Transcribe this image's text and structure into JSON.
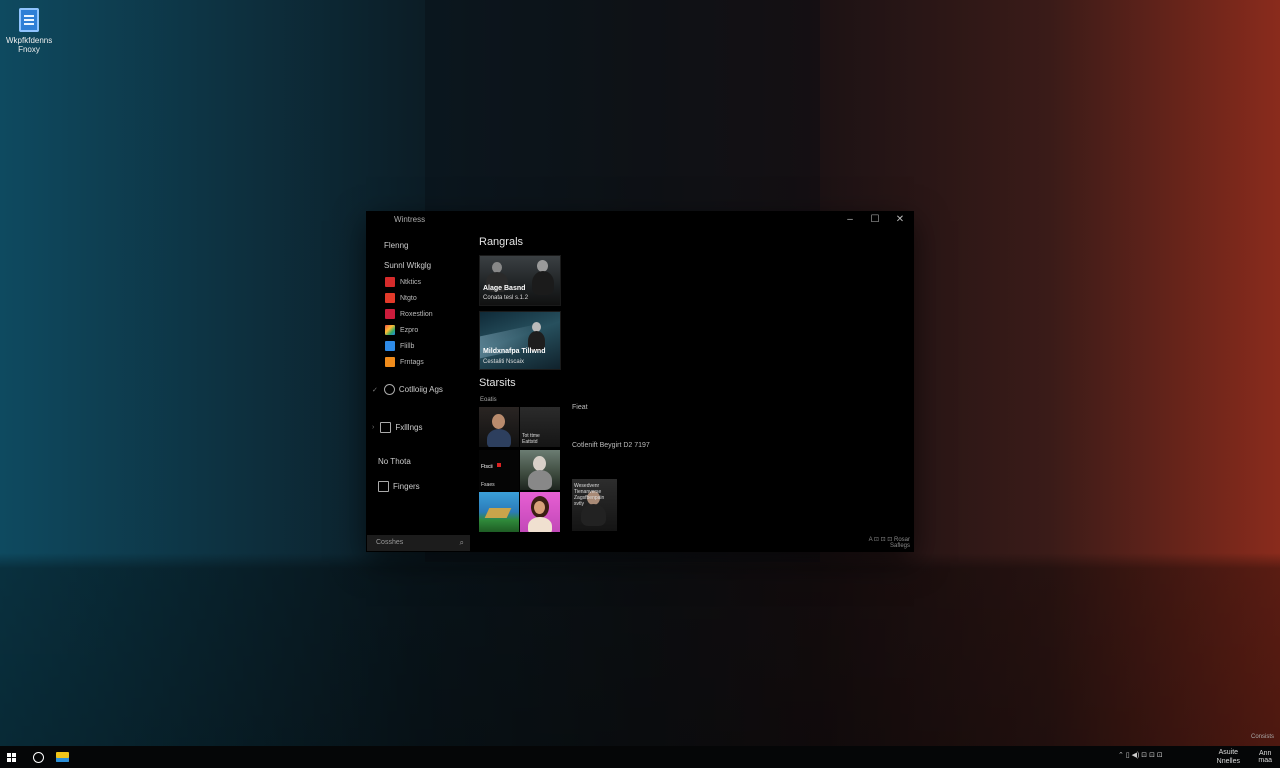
{
  "desktop": {
    "icon_label": "Wkpfkfdenns\nFnoxy",
    "corner_note": "Consists"
  },
  "window": {
    "title": "Wintress",
    "controls": {
      "minimize": "–",
      "maximize": "☐",
      "close": "✕"
    }
  },
  "sidebar": {
    "top_item": "Flenng",
    "group_label": "Sunnl Wtkglg",
    "apps": [
      {
        "label": "Ntktics",
        "color": "#d62b2b"
      },
      {
        "label": "Ntgto",
        "color": "#e23a2a"
      },
      {
        "label": "Roxestlion",
        "color": "#cc1c3c"
      },
      {
        "label": "Ezpro",
        "color": "#3aa86b"
      },
      {
        "label": "Flillb",
        "color": "#2e8ae6"
      },
      {
        "label": "Frntags",
        "color": "#f08c1c"
      }
    ],
    "item_controlling": "Cotlloiig Ags",
    "item_fallings": "Fxlllngs",
    "item_no_thota": "No Thota",
    "item_fingers": "Fingers",
    "search_placeholder": "Cosshes"
  },
  "content": {
    "section1_title": "Rangrals",
    "card1": {
      "title": "Alage Basnd",
      "subtitle": "Conata tesl s.1.2"
    },
    "card2": {
      "title": "Mildxnafpa Tillwnd",
      "subtitle": "Cestaliti Nscaix"
    },
    "section2_title": "Starsits",
    "section2_sub": "Eoatis",
    "tiles": [
      {
        "caption": ""
      },
      {
        "caption": "Tot ttme\nEattstd"
      },
      {
        "caption": "Ftscii"
      },
      {
        "caption": "Fsaes"
      },
      {
        "caption": ""
      },
      {
        "caption": ""
      }
    ],
    "right_heading": "Fieat",
    "right_detail": "Cotlenift Beygirt D2 7197",
    "preview_caption": "Wesedvenr\nTienanverse\nZagsfbenpain\nsvtly",
    "statusbar": "A  ⊡  ⊡  ⊡ Rosar\n     Saflegs"
  },
  "taskbar": {
    "tray_icons": "⌃  ▯  ◀)  ⊡  ⊡  ⊡",
    "clock_time": "Asuite",
    "clock_date": "Nnelles",
    "notify": "Ann\nmaa"
  }
}
